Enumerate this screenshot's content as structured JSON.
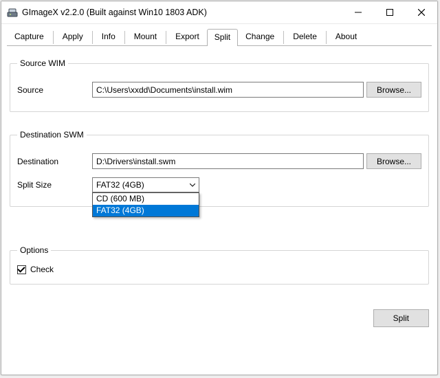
{
  "window": {
    "title": "GImageX v2.2.0 (Built against Win10 1803 ADK)"
  },
  "tabs": {
    "items": [
      {
        "label": "Capture"
      },
      {
        "label": "Apply"
      },
      {
        "label": "Info"
      },
      {
        "label": "Mount"
      },
      {
        "label": "Export"
      },
      {
        "label": "Split"
      },
      {
        "label": "Change"
      },
      {
        "label": "Delete"
      },
      {
        "label": "About"
      }
    ],
    "active_index": 5
  },
  "groups": {
    "source": {
      "legend": "Source WIM",
      "source_label": "Source",
      "source_value": "C:\\Users\\xxdd\\Documents\\install.wim",
      "browse_label": "Browse..."
    },
    "dest": {
      "legend": "Destination SWM",
      "destination_label": "Destination",
      "destination_value": "D:\\Drivers\\install.swm",
      "browse_label": "Browse...",
      "splitsize_label": "Split Size",
      "splitsize_value": "FAT32 (4GB)",
      "splitsize_options": [
        {
          "label": "CD (600 MB)"
        },
        {
          "label": "FAT32 (4GB)"
        }
      ],
      "splitsize_selected_index": 1
    },
    "options": {
      "legend": "Options",
      "check_label": "Check",
      "check_checked": true
    }
  },
  "actions": {
    "split_label": "Split"
  }
}
